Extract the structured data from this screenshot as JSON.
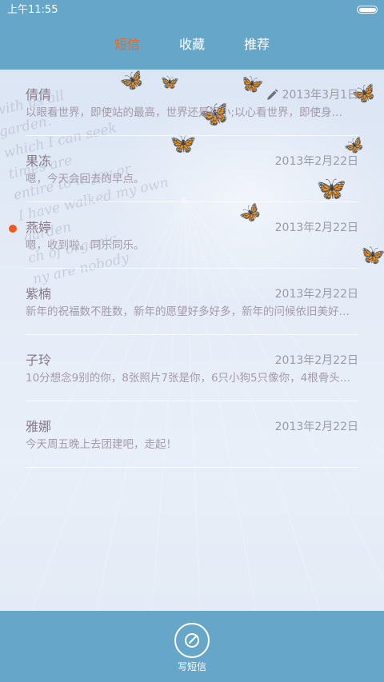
{
  "status_bar": {
    "time": "上午11:55"
  },
  "tabs": [
    {
      "label": "短信",
      "active": true
    },
    {
      "label": "收藏",
      "active": false
    },
    {
      "label": "推荐",
      "active": false
    }
  ],
  "colors": {
    "bar": "#65a6c9",
    "active_tab": "#e06a26",
    "unread_dot": "#f05a1e"
  },
  "background_script": [
    "with us all",
    "garden.",
    "which I can seek",
    "times are",
    "entire to in joy or",
    "I have walked my own",
    "garden",
    "ch of organic",
    "ny are nobody"
  ],
  "messages": [
    {
      "name": "倩倩",
      "date": "2013年3月1日",
      "preview": "以眼看世界，即使站的最高，世界还是很小;以心看世界，即使身…",
      "draft": true,
      "unread": false
    },
    {
      "name": "果冻",
      "date": "2013年2月22日",
      "preview": "嗯，今天会回去的早点。",
      "draft": false,
      "unread": false
    },
    {
      "name": "燕婷",
      "date": "2013年2月22日",
      "preview": "嗯，收到啦。同乐同乐。",
      "draft": false,
      "unread": true
    },
    {
      "name": "紫楠",
      "date": "2013年2月22日",
      "preview": "新年的祝福数不胜数，新年的愿望好多好多，新年的问候依旧美好…",
      "draft": false,
      "unread": false
    },
    {
      "name": "子玲",
      "date": "2013年2月22日",
      "preview": "10分想念9别的你，8张照片7张是你，6只小狗5只像你，4根骨头…",
      "draft": false,
      "unread": false
    },
    {
      "name": "雅娜",
      "date": "2013年2月22日",
      "preview": "今天周五晚上去团建吧，走起！",
      "draft": false,
      "unread": false
    }
  ],
  "bottom": {
    "compose_label": "写短信",
    "compose_icon": "compose-pen-icon"
  }
}
